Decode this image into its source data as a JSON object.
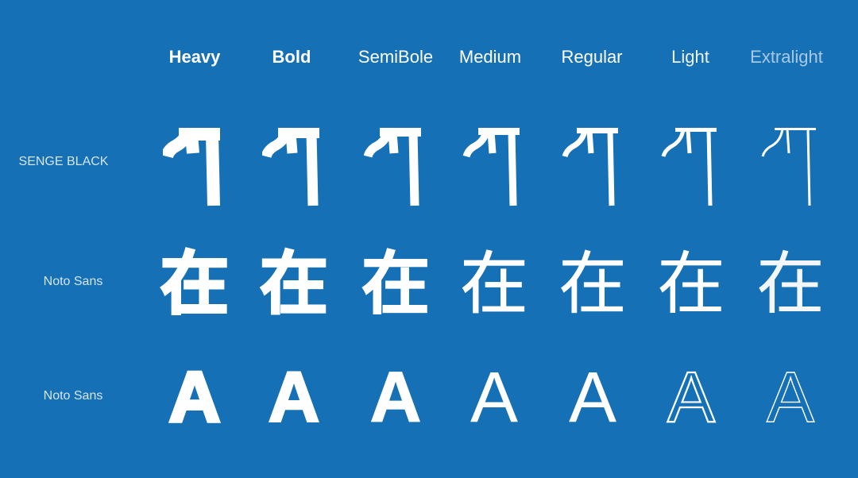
{
  "colors": {
    "background": "#1670b5",
    "text": "#ffffff",
    "row_label": "#d6e6f4",
    "extralight_header": "#a9cbe8"
  },
  "weights": [
    {
      "label": "Heavy",
      "value": 900
    },
    {
      "label": "Bold",
      "value": 700
    },
    {
      "label": "SemiBole",
      "value": 600
    },
    {
      "label": "Medium",
      "value": 500
    },
    {
      "label": "Regular",
      "value": 400
    },
    {
      "label": "Light",
      "value": 300
    },
    {
      "label": "Extralight",
      "value": 200
    }
  ],
  "rows": [
    {
      "label": "SENGE BLACK",
      "sample": "ག",
      "script": "tibetan"
    },
    {
      "label": "Noto Sans",
      "sample": "在",
      "script": "cjk"
    },
    {
      "label": "Noto Sans",
      "sample": "A",
      "script": "latin"
    }
  ]
}
